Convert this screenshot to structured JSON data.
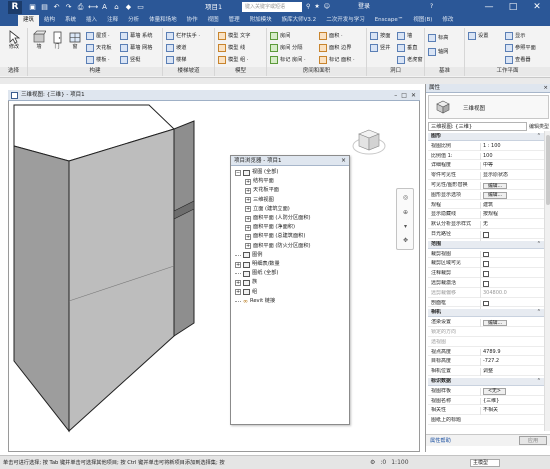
{
  "app": {
    "logo": "R",
    "window_title": "项目1",
    "search_placeholder": "键入关键字或短语",
    "user_label": "登录",
    "help_label": "?",
    "window_buttons": [
      "—",
      "□",
      "✕"
    ]
  },
  "ribbon": {
    "tabs": [
      "建筑",
      "结构",
      "系统",
      "插入",
      "注释",
      "分析",
      "体量和场地",
      "协作",
      "视图",
      "管理",
      "附加模块",
      "族库大师V3.2",
      "二次开发与学习",
      "Enscape™",
      "视图(B)",
      "修改"
    ],
    "active_tab_index": 0,
    "groups": {
      "select": {
        "label": "选择",
        "modify": "修改"
      },
      "build": {
        "label": "构建",
        "big": [
          "墙",
          "门",
          "窗"
        ],
        "rows": [
          "屋顶 ·",
          "天花板",
          "楼板 ·",
          "幕墙 系统",
          "幕墙 网格",
          "竖梃"
        ]
      },
      "circulation": {
        "label": "楼梯坡道",
        "rows": [
          "栏杆扶手 ·",
          "坡道",
          "楼梯"
        ]
      },
      "model": {
        "label": "模型",
        "rows": [
          "模型 文字",
          "模型 线",
          "模型 组 ·"
        ]
      },
      "room": {
        "label": "房间和面积",
        "rows": [
          "房间",
          "房间 分隔",
          "标记 房间 ·",
          "面积 ·",
          "面积 边界",
          "标记 面积 ·"
        ]
      },
      "opening": {
        "label": "洞口",
        "rows": [
          "按面",
          "竖井",
          "墙",
          "垂直",
          "老虎窗"
        ]
      },
      "datum": {
        "label": "基准",
        "rows": [
          "标高",
          "轴网"
        ]
      },
      "workplane": {
        "label": "工作平面",
        "rows": [
          "设置",
          "显示",
          "参照平面",
          "查看器"
        ]
      }
    }
  },
  "view": {
    "tab_title": "三维视图: {三维} - 项目1",
    "tab_buttons": [
      "–",
      "□",
      "✕"
    ]
  },
  "browser": {
    "title": "项目浏览器 - 项目1",
    "close": "×",
    "items": [
      {
        "label": "视图 (全部)",
        "level": 0,
        "toggle": "⊟"
      },
      {
        "label": "结构平面",
        "level": 1,
        "toggle": "⊞"
      },
      {
        "label": "天花板平面",
        "level": 1,
        "toggle": "⊞"
      },
      {
        "label": "三维视图",
        "level": 1,
        "toggle": "⊞"
      },
      {
        "label": "立面 (建筑立面)",
        "level": 1,
        "toggle": "⊞"
      },
      {
        "label": "面积平面 (人防分区面积)",
        "level": 1,
        "toggle": "⊞"
      },
      {
        "label": "面积平面 (净面积)",
        "level": 1,
        "toggle": "⊞"
      },
      {
        "label": "面积平面 (总建筑面积)",
        "level": 1,
        "toggle": "⊞"
      },
      {
        "label": "面积平面 (防火分区面积)",
        "level": 1,
        "toggle": "⊞"
      },
      {
        "label": "图例",
        "level": 0,
        "toggle": ""
      },
      {
        "label": "明细表/数量",
        "level": 0,
        "toggle": "⊞"
      },
      {
        "label": "图纸 (全部)",
        "level": 0,
        "toggle": ""
      },
      {
        "label": "族",
        "level": 0,
        "toggle": "⊞"
      },
      {
        "label": "组",
        "level": 0,
        "toggle": "⊞"
      },
      {
        "label": "Revit 链接",
        "level": 0,
        "toggle": ""
      }
    ]
  },
  "properties": {
    "title": "属性",
    "close": "×",
    "type_name": "三维视图",
    "selector": "三维视图: {三维}",
    "edit_type": "编辑类型",
    "rows": [
      {
        "k": "图形",
        "v": "",
        "kind": "section"
      },
      {
        "k": "视图比例",
        "v": "1 : 100"
      },
      {
        "k": "比例值 1:",
        "v": "100"
      },
      {
        "k": "详细程度",
        "v": "中等"
      },
      {
        "k": "零件可见性",
        "v": "显示原状态"
      },
      {
        "k": "可见性/图形替换",
        "v": "编辑...",
        "kind": "button"
      },
      {
        "k": "图形显示选项",
        "v": "编辑...",
        "kind": "button"
      },
      {
        "k": "规程",
        "v": "建筑"
      },
      {
        "k": "显示隐藏线",
        "v": "按规程"
      },
      {
        "k": "默认分析显示样式",
        "v": "无"
      },
      {
        "k": "日光路径",
        "v": "",
        "kind": "check"
      },
      {
        "k": "范围",
        "v": "",
        "kind": "section"
      },
      {
        "k": "裁剪视图",
        "v": "",
        "kind": "check"
      },
      {
        "k": "裁剪区域可见",
        "v": "",
        "kind": "check"
      },
      {
        "k": "注释裁剪",
        "v": "",
        "kind": "check"
      },
      {
        "k": "远剪裁激活",
        "v": "",
        "kind": "check"
      },
      {
        "k": "远剪裁偏移",
        "v": "304800.0",
        "kind": "grey"
      },
      {
        "k": "剖面框",
        "v": "",
        "kind": "check"
      },
      {
        "k": "相机",
        "v": "",
        "kind": "section"
      },
      {
        "k": "渲染设置",
        "v": "编辑...",
        "kind": "button"
      },
      {
        "k": "锁定的方向",
        "v": "",
        "kind": "grey"
      },
      {
        "k": "透视图",
        "v": "",
        "kind": "grey"
      },
      {
        "k": "视点高度",
        "v": "4789.9"
      },
      {
        "k": "目标高度",
        "v": "-727.2"
      },
      {
        "k": "相机位置",
        "v": "调整"
      },
      {
        "k": "标识数据",
        "v": "",
        "kind": "section"
      },
      {
        "k": "视图样板",
        "v": "<无>",
        "kind": "button"
      },
      {
        "k": "视图名称",
        "v": "{三维}"
      },
      {
        "k": "相关性",
        "v": "不相关"
      },
      {
        "k": "图纸上的标题",
        "v": ""
      }
    ],
    "help_link": "属性帮助",
    "apply": "应用"
  },
  "statusbar": {
    "message": "单击可进行选择; 按 Tab 键并单击可选择其他项目; 按 Ctrl 键并单击可将新项目添加到选择集; 按",
    "scale": "1:100",
    "zoom": "主模型",
    "filter": ":0"
  }
}
